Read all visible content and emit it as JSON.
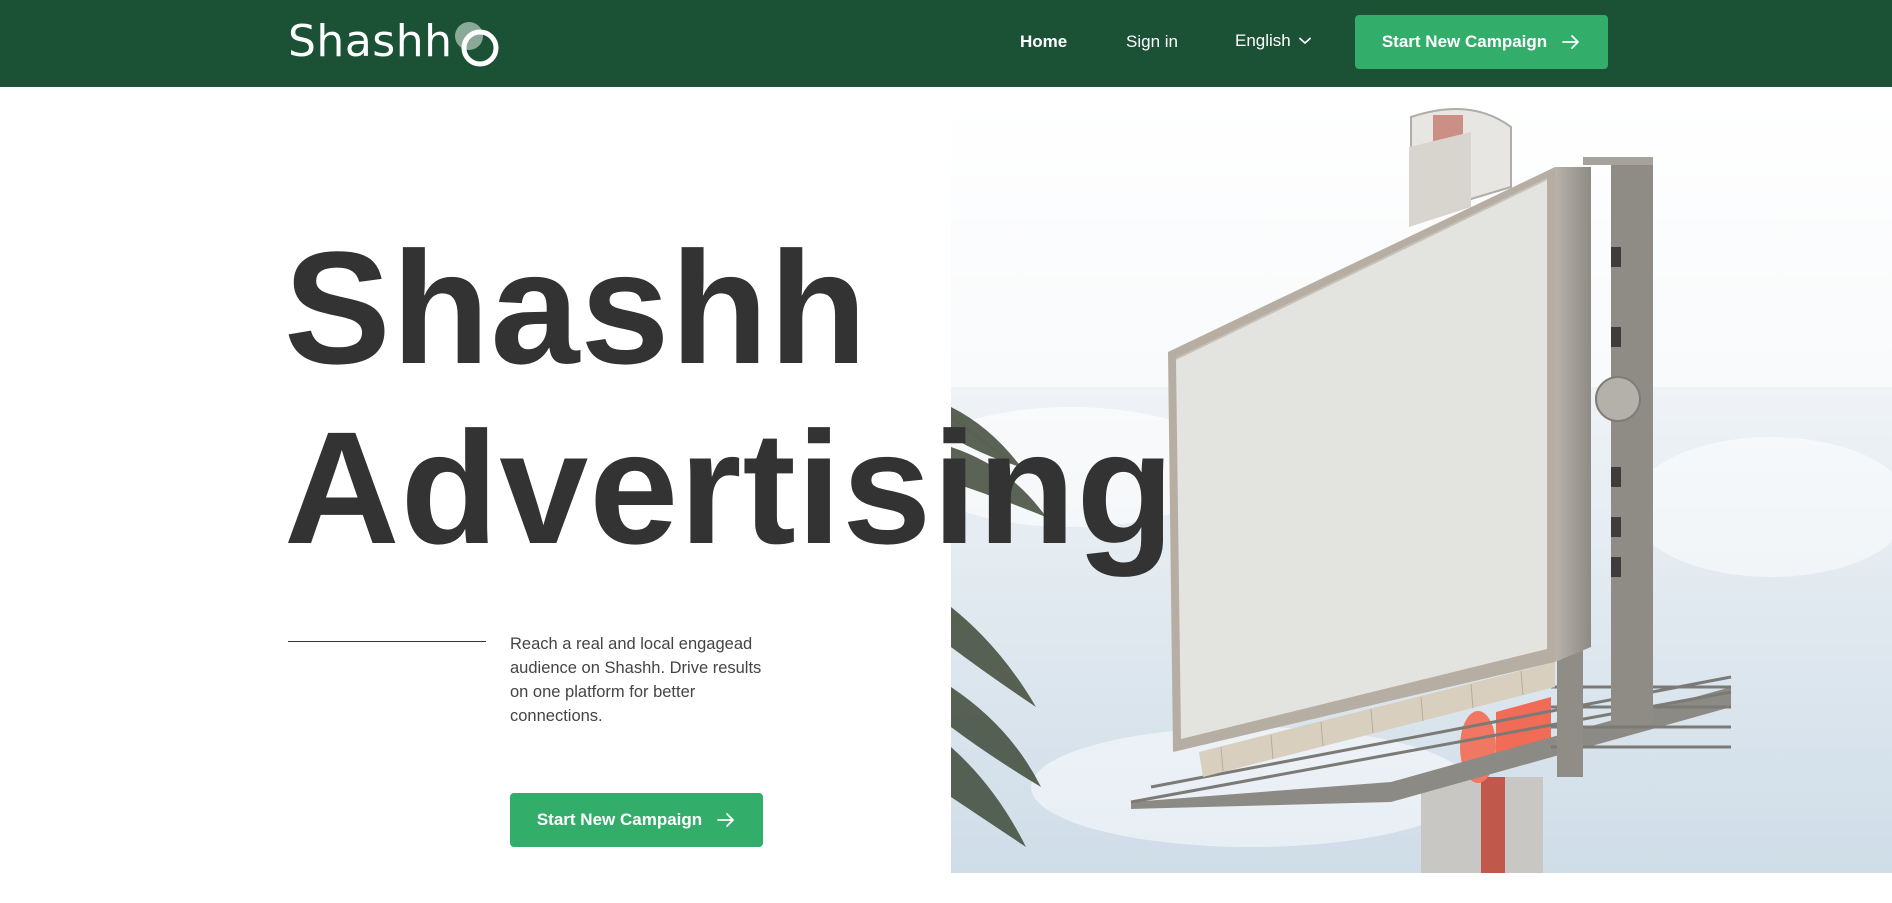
{
  "brand": {
    "name": "Shashh",
    "primary_color": "#1b5235",
    "accent_color": "#33ad6a",
    "text_color": "#333333"
  },
  "nav": {
    "home_label": "Home",
    "signin_label": "Sign in",
    "language_label": "English",
    "cta_label": "Start New Campaign"
  },
  "hero": {
    "title_line1": "Shashh",
    "title_line2": "Advertising",
    "description": "Reach a real and local engagead audience on Shashh. Drive results on one platform for better connections.",
    "cta_label": "Start New Campaign",
    "image": "billboard-photo"
  },
  "icons": {
    "arrow": "arrow-right-icon",
    "chevron": "chevron-down-icon"
  }
}
